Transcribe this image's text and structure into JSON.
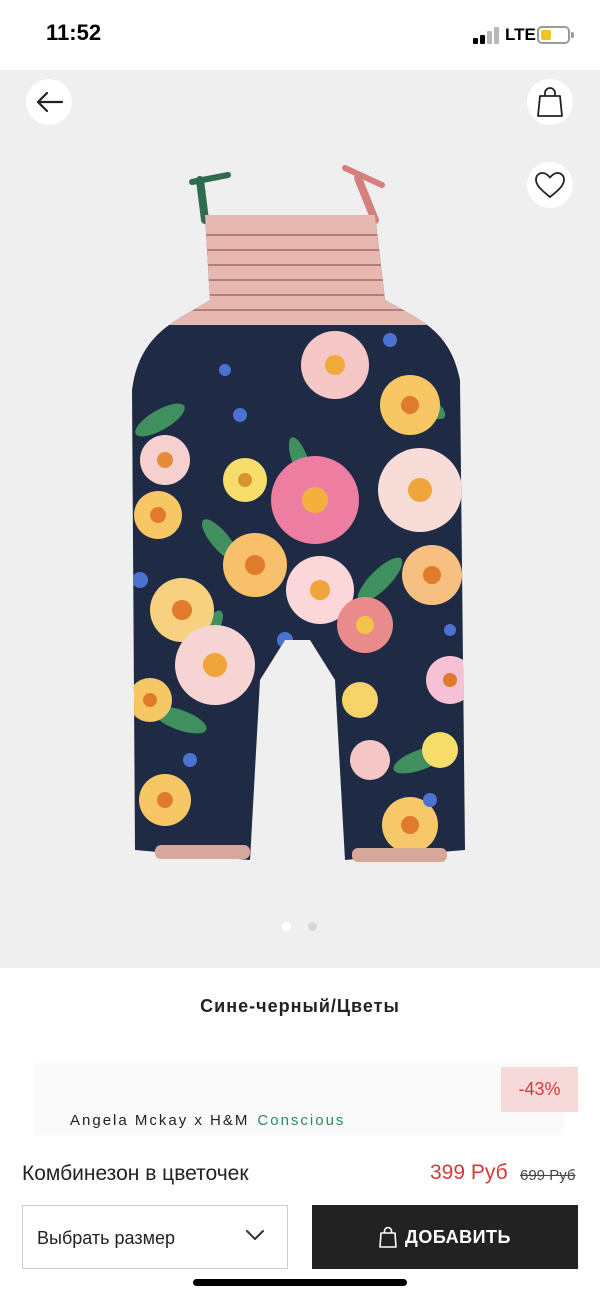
{
  "status_bar": {
    "time": "11:52",
    "network": "LTE",
    "battery_level": 0.4
  },
  "nav": {
    "back_icon": "arrow-left-icon",
    "bag_icon": "shopping-bag-icon",
    "wishlist_icon": "heart-icon"
  },
  "gallery": {
    "page_count": 2,
    "current_page": 1
  },
  "product": {
    "color_name": "Сине-черный/Цветы",
    "brand": "Angela Mckay x H&M",
    "brand_tag": "Conscious",
    "discount": "-43%",
    "title": "Комбинезон в цветочек",
    "price_now": "399 Руб",
    "price_old": "699 Руб"
  },
  "actions": {
    "size_select_label": "Выбрать размер",
    "add_button_label": "ДОБАВИТЬ"
  },
  "colors": {
    "accent_price": "#d23a3a",
    "brand_tag": "#2e8b57",
    "button_bg": "#222222"
  }
}
